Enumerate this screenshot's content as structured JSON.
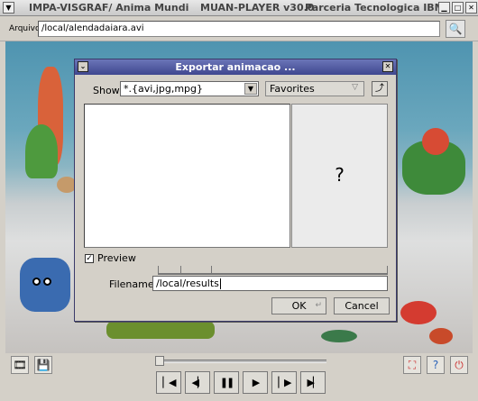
{
  "window": {
    "title_left": "IMPA-VISGRAF/ Anima Mundi",
    "title_center": "MUAN-PLAYER v30.0",
    "title_right": "Parceria Tecnologica IBM"
  },
  "file_bar": {
    "label": "Arquivo:",
    "path": "/local/alendadaiara.avi"
  },
  "dialog": {
    "title": "Exportar animacao ...",
    "show_label": "Show:",
    "filter_value": "*.{avi,jpg,mpg}",
    "favorites_label": "Favorites",
    "preview_placeholder": "?",
    "preview_label": "Preview",
    "preview_checked": true,
    "filename_label": "Filename:",
    "filename_value": "/local/results",
    "ok_label": "OK",
    "cancel_label": "Cancel"
  },
  "toolbar": {
    "icons": [
      "open-movie-icon",
      "save-icon",
      "fullscreen-icon",
      "help-icon",
      "exit-icon"
    ],
    "playback": [
      "first-frame-icon",
      "step-back-icon",
      "pause-icon",
      "play-icon",
      "step-forward-icon",
      "last-frame-icon"
    ]
  },
  "colors": {
    "dialog_title_bg": "#4a539a",
    "canvas_sky": "#4f94b0",
    "canvas_sand": "#d9d9d9"
  }
}
